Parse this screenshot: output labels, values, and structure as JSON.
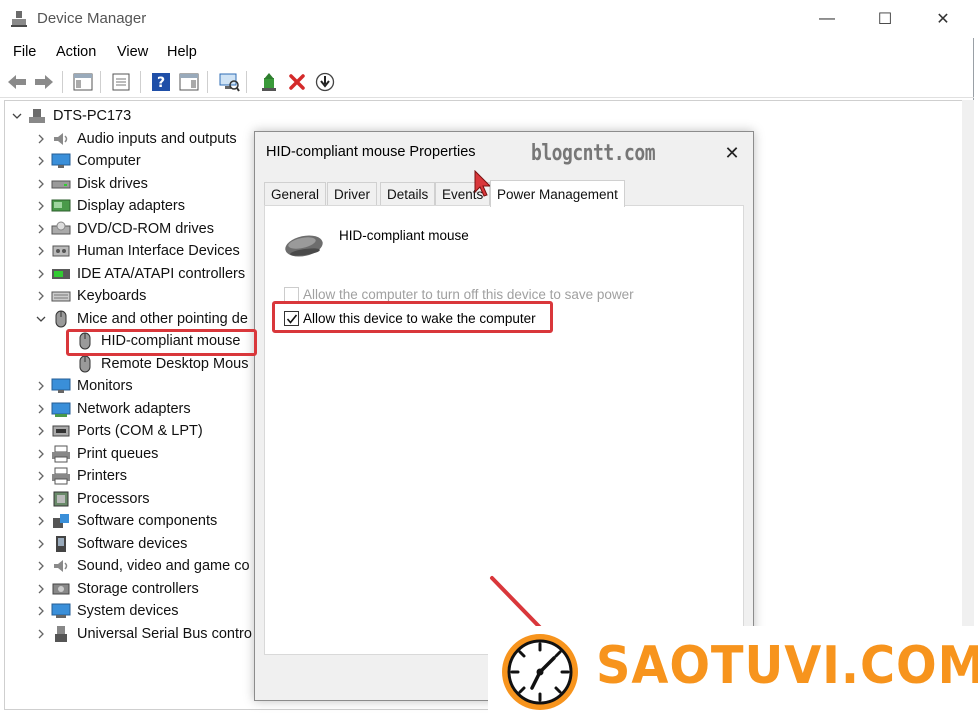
{
  "window": {
    "title": "Device Manager",
    "controls": {
      "minimize": "—",
      "maximize": "☐",
      "close": "✕"
    }
  },
  "menu": [
    "File",
    "Action",
    "View",
    "Help"
  ],
  "tree": {
    "root": "DTS-PC173",
    "items": [
      {
        "label": "Audio inputs and outputs",
        "icon": "speaker-icon",
        "expanded": false
      },
      {
        "label": "Computer",
        "icon": "monitor-icon",
        "expanded": false
      },
      {
        "label": "Disk drives",
        "icon": "disk-icon",
        "expanded": false
      },
      {
        "label": "Display adapters",
        "icon": "display-adapter-icon",
        "expanded": false
      },
      {
        "label": "DVD/CD-ROM drives",
        "icon": "dvd-icon",
        "expanded": false
      },
      {
        "label": "Human Interface Devices",
        "icon": "hid-icon",
        "expanded": false
      },
      {
        "label": "IDE ATA/ATAPI controllers",
        "icon": "ide-icon",
        "expanded": false
      },
      {
        "label": "Keyboards",
        "icon": "keyboard-icon",
        "expanded": false
      },
      {
        "label": "Mice and other pointing de",
        "icon": "mouse-icon",
        "expanded": true
      },
      {
        "label": "HID-compliant mouse",
        "icon": "mouse-icon",
        "child": true
      },
      {
        "label": "Remote Desktop Mous",
        "icon": "mouse-icon",
        "child": true
      },
      {
        "label": "Monitors",
        "icon": "monitor-icon",
        "expanded": false
      },
      {
        "label": "Network adapters",
        "icon": "network-icon",
        "expanded": false
      },
      {
        "label": "Ports (COM & LPT)",
        "icon": "port-icon",
        "expanded": false
      },
      {
        "label": "Print queues",
        "icon": "printer-icon",
        "expanded": false
      },
      {
        "label": "Printers",
        "icon": "printer-icon",
        "expanded": false
      },
      {
        "label": "Processors",
        "icon": "processor-icon",
        "expanded": false
      },
      {
        "label": "Software components",
        "icon": "software-component-icon",
        "expanded": false
      },
      {
        "label": "Software devices",
        "icon": "software-device-icon",
        "expanded": false
      },
      {
        "label": "Sound, video and game co",
        "icon": "speaker-icon",
        "expanded": false
      },
      {
        "label": "Storage controllers",
        "icon": "storage-icon",
        "expanded": false
      },
      {
        "label": "System devices",
        "icon": "system-icon",
        "expanded": false
      },
      {
        "label": "Universal Serial Bus contro",
        "icon": "usb-icon",
        "expanded": false
      }
    ]
  },
  "dialog": {
    "title": "HID-compliant mouse Properties",
    "watermark": "blogcntt.com",
    "close": "✕",
    "tabs": [
      "General",
      "Driver",
      "Details",
      "Events",
      "Power Management"
    ],
    "active_tab": "Power Management",
    "device_name": "HID-compliant mouse",
    "options": [
      {
        "label": "Allow the computer to turn off this device to save power",
        "checked": false,
        "disabled": true
      },
      {
        "label": "Allow this device to wake the computer",
        "checked": true,
        "disabled": false
      }
    ]
  },
  "logo": {
    "text": "SAOTUVI.COM"
  },
  "colors": {
    "highlight": "#d9373b",
    "logo": "#f7941d"
  }
}
